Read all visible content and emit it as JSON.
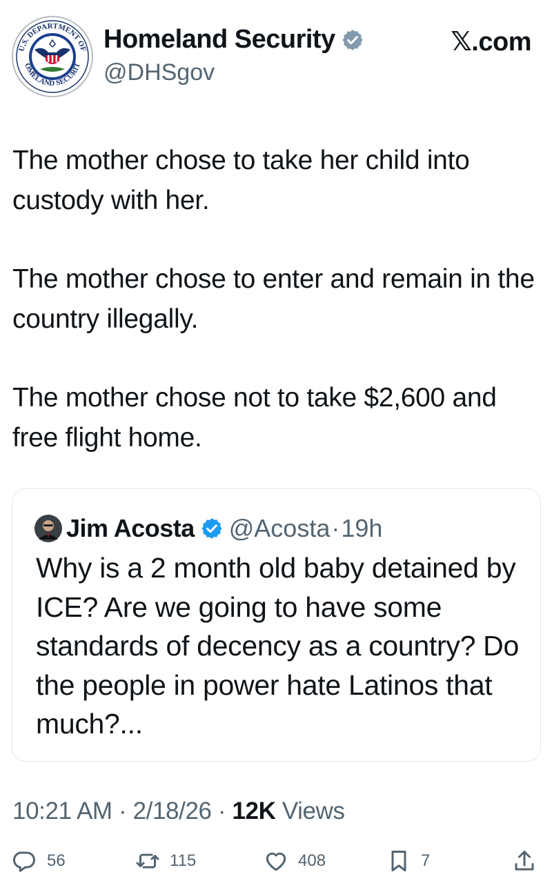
{
  "header": {
    "display_name": "Homeland Security",
    "handle": "@DHSgov",
    "site_label": "𝕏.com",
    "avatar_icon": "dhs-seal-icon",
    "seal_text_top": "U.S. DEPARTMENT OF",
    "seal_text_bottom": "HOMELAND SECURITY"
  },
  "post": {
    "paragraphs": [
      "The mother chose to take her child into custody with her.",
      "The mother chose to enter and remain in the country illegally.",
      "The mother chose not to take $2,600 and free flight home."
    ]
  },
  "quote": {
    "name": "Jim Acosta",
    "handle": "@Acosta",
    "separator": "·",
    "time": "19h",
    "text": "Why is a 2 month old baby detained by ICE? Are we going to have some standards of decency as a country? Do the people in power hate Latinos that much?..."
  },
  "meta": {
    "time": "10:21 AM",
    "sep1": " · ",
    "date": "2/18/26",
    "sep2": " · ",
    "views_count": "12K",
    "views_label": " Views"
  },
  "actions": {
    "replies": "56",
    "reposts": "115",
    "likes": "408",
    "bookmarks": "7"
  },
  "colors": {
    "text_primary": "#0f1419",
    "text_secondary": "#536471",
    "verified_gray": "#829aab",
    "verified_blue": "#1d9bf0",
    "border": "#e1e6ea"
  }
}
